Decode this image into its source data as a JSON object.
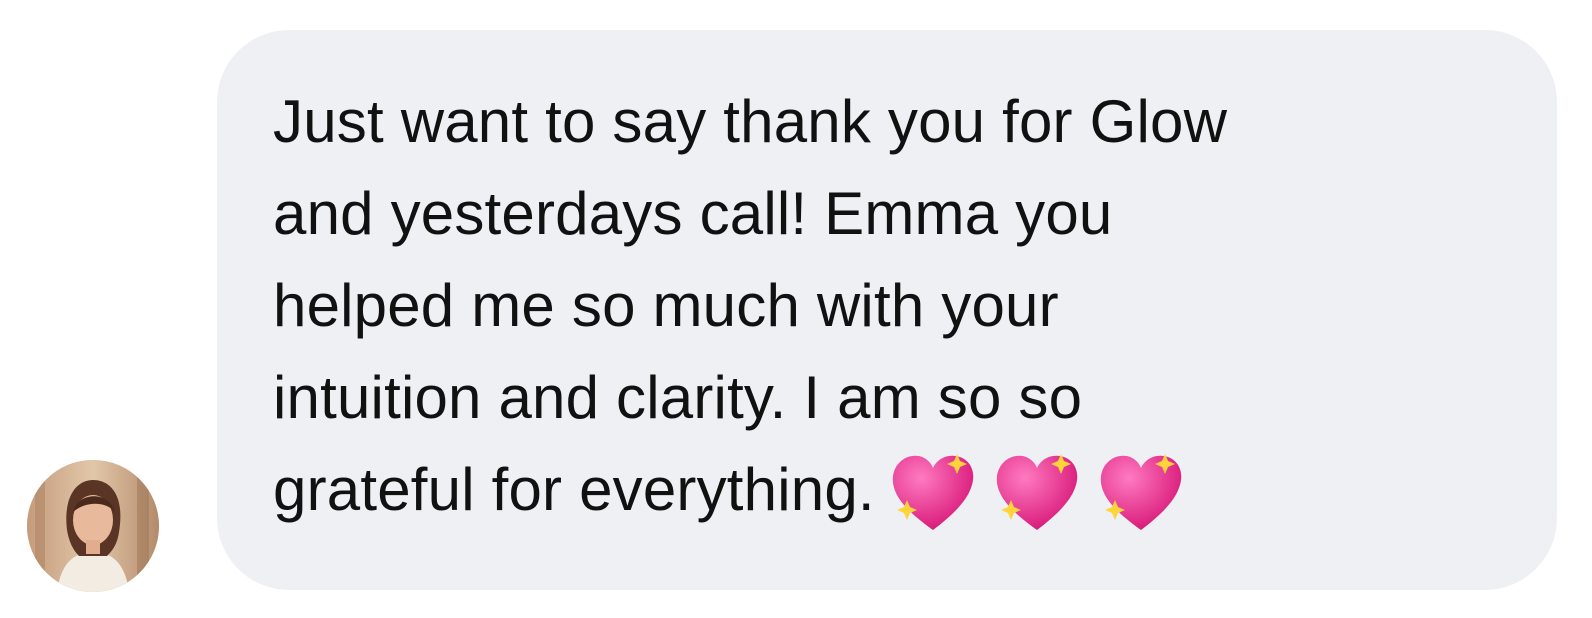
{
  "conversation": {
    "sender_avatar": {
      "icon": "profile-photo"
    },
    "message": {
      "lines": [
        "Just want to say thank you for Glow",
        "and yesterdays call! Emma you",
        "helped me so much with your",
        "intuition and clarity. I am so so",
        "grateful for everything."
      ],
      "emoji": [
        "sparkling-heart-icon",
        "sparkling-heart-icon",
        "sparkling-heart-icon"
      ],
      "bubble_color": "#eff0f4",
      "text_color": "#111111",
      "emoji_color": "#e3207f"
    }
  }
}
